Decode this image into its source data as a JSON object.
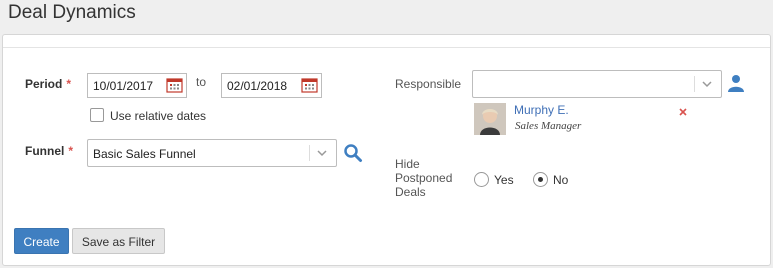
{
  "page": {
    "title": "Deal Dynamics"
  },
  "form": {
    "period": {
      "label": "Period",
      "required_mark": "*",
      "from": "10/01/2017",
      "to_label": "to",
      "to": "02/01/2018",
      "relative_label": "Use relative dates",
      "relative_checked": false
    },
    "funnel": {
      "label": "Funnel",
      "required_mark": "*",
      "value": "Basic Sales Funnel"
    },
    "responsible": {
      "label": "Responsible",
      "value": "",
      "person": {
        "name": "Murphy E.",
        "role": "Sales Manager"
      }
    },
    "hide_postponed": {
      "label_line1": "Hide",
      "label_line2": "Postponed",
      "label_line3": "Deals",
      "options": [
        {
          "label": "Yes",
          "checked": false
        },
        {
          "label": "No",
          "checked": true
        }
      ]
    }
  },
  "actions": {
    "create_label": "Create",
    "save_filter_label": "Save as Filter"
  },
  "colors": {
    "primary": "#3f7fc1",
    "required": "#d9534f",
    "link": "#3f6fb6",
    "remove": "#d9534f",
    "icon_blue": "#3f7fc1"
  },
  "icons": {
    "calendar": "calendar-icon",
    "search": "search-icon",
    "user": "user-icon",
    "remove": "remove-icon",
    "chevron": "chevron-down-icon"
  }
}
